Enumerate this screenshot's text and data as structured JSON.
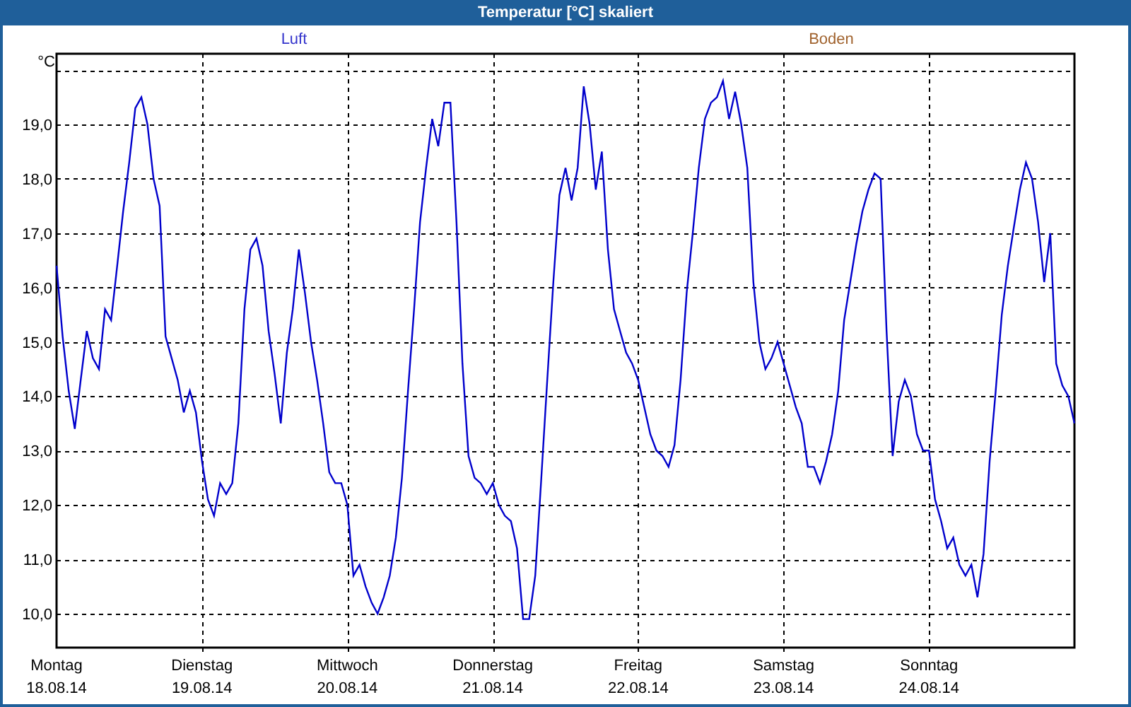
{
  "window": {
    "title": "Temperatur [°C] skaliert"
  },
  "legend": [
    {
      "label": "Luft",
      "color": "#3333cc"
    },
    {
      "label": "Boden",
      "color": "#a0622d"
    }
  ],
  "chart_data": {
    "type": "line",
    "grid": true,
    "ylabel": "°C",
    "ylim": [
      9.375,
      20.3
    ],
    "categories": [
      "Montag\n18.08.14",
      null,
      null,
      null,
      null,
      null,
      null,
      null,
      null,
      null,
      null,
      null,
      null,
      null,
      null,
      null,
      null,
      null,
      null,
      null,
      null,
      null,
      null,
      null,
      "Dienstag\n19.08.14",
      null,
      null,
      null,
      null,
      null,
      null,
      null,
      null,
      null,
      null,
      null,
      null,
      null,
      null,
      null,
      null,
      null,
      null,
      null,
      null,
      null,
      null,
      null,
      "Mittwoch\n20.08.14",
      null,
      null,
      null,
      null,
      null,
      null,
      null,
      null,
      null,
      null,
      null,
      null,
      null,
      null,
      null,
      null,
      null,
      null,
      null,
      null,
      null,
      null,
      null,
      "Donnerstag\n21.08.14",
      null,
      null,
      null,
      null,
      null,
      null,
      null,
      null,
      null,
      null,
      null,
      null,
      null,
      null,
      null,
      null,
      null,
      null,
      null,
      null,
      null,
      null,
      null,
      "Freitag\n22.08.14",
      null,
      null,
      null,
      null,
      null,
      null,
      null,
      null,
      null,
      null,
      null,
      null,
      null,
      null,
      null,
      null,
      null,
      null,
      null,
      null,
      null,
      null,
      null,
      "Samstag\n23.08.14",
      null,
      null,
      null,
      null,
      null,
      null,
      null,
      null,
      null,
      null,
      null,
      null,
      null,
      null,
      null,
      null,
      null,
      null,
      null,
      null,
      null,
      null,
      null,
      "Sonntag\n24.08.14",
      null,
      null,
      null,
      null,
      null,
      null,
      null,
      null,
      null,
      null,
      null,
      null,
      null,
      null,
      null,
      null,
      null,
      null,
      null,
      null,
      null,
      null,
      null,
      null
    ],
    "yticks": [
      {
        "value": 10,
        "label": "10,0"
      },
      {
        "value": 11,
        "label": "11,0"
      },
      {
        "value": 12,
        "label": "12,0"
      },
      {
        "value": 13,
        "label": "13,0"
      },
      {
        "value": 14,
        "label": "14,0"
      },
      {
        "value": 15,
        "label": "15,0"
      },
      {
        "value": 16,
        "label": "16,0"
      },
      {
        "value": 17,
        "label": "17,0"
      },
      {
        "value": 18,
        "label": "18,0"
      },
      {
        "value": 19,
        "label": "19,0"
      }
    ],
    "series": [
      {
        "color": "#0000cc",
        "values": [
          16.4,
          15.1,
          14.1,
          13.4,
          14.3,
          15.2,
          14.7,
          14.5,
          15.6,
          15.4,
          16.4,
          17.4,
          18.3,
          19.3,
          19.5,
          19.0,
          18.0,
          17.5,
          15.1,
          14.7,
          14.3,
          13.7,
          14.1,
          13.7,
          12.8,
          12.1,
          11.8,
          12.4,
          12.2,
          12.4,
          13.5,
          15.6,
          16.7,
          16.9,
          16.4,
          15.2,
          14.4,
          13.5,
          14.8,
          15.6,
          16.7,
          15.9,
          15.0,
          14.3,
          13.5,
          12.6,
          12.4,
          12.4,
          12.0,
          10.7,
          10.9,
          10.5,
          10.2,
          10.0,
          10.3,
          10.7,
          11.4,
          12.5,
          14.1,
          15.6,
          17.2,
          18.2,
          19.1,
          18.6,
          19.4,
          19.4,
          17.2,
          14.6,
          12.9,
          12.5,
          12.4,
          12.2,
          12.4,
          12.0,
          11.8,
          11.7,
          11.2,
          9.9,
          9.9,
          10.7,
          12.5,
          14.3,
          16.1,
          17.7,
          18.2,
          17.6,
          18.2,
          19.7,
          19.0,
          17.8,
          18.5,
          16.7,
          15.6,
          15.2,
          14.8,
          14.6,
          14.3,
          13.8,
          13.3,
          13.0,
          12.9,
          12.7,
          13.1,
          14.3,
          15.9,
          17.0,
          18.2,
          19.1,
          19.4,
          19.5,
          19.8,
          19.1,
          19.6,
          19.0,
          18.2,
          16.1,
          15.0,
          14.5,
          14.7,
          15.0,
          14.6,
          14.2,
          13.8,
          13.5,
          12.7,
          12.7,
          12.4,
          12.8,
          13.3,
          14.1,
          15.4,
          16.1,
          16.8,
          17.4,
          17.8,
          18.1,
          18.0,
          15.2,
          12.9,
          13.9,
          14.3,
          14.0,
          13.3,
          13.0,
          13.0,
          12.1,
          11.7,
          11.2,
          11.4,
          10.9,
          10.7,
          10.9,
          10.3,
          11.1,
          12.8,
          14.1,
          15.5,
          16.4,
          17.1,
          17.8,
          18.3,
          18.0,
          17.2,
          16.1,
          17.0,
          14.6,
          14.2,
          14.0,
          13.5
        ]
      }
    ]
  }
}
